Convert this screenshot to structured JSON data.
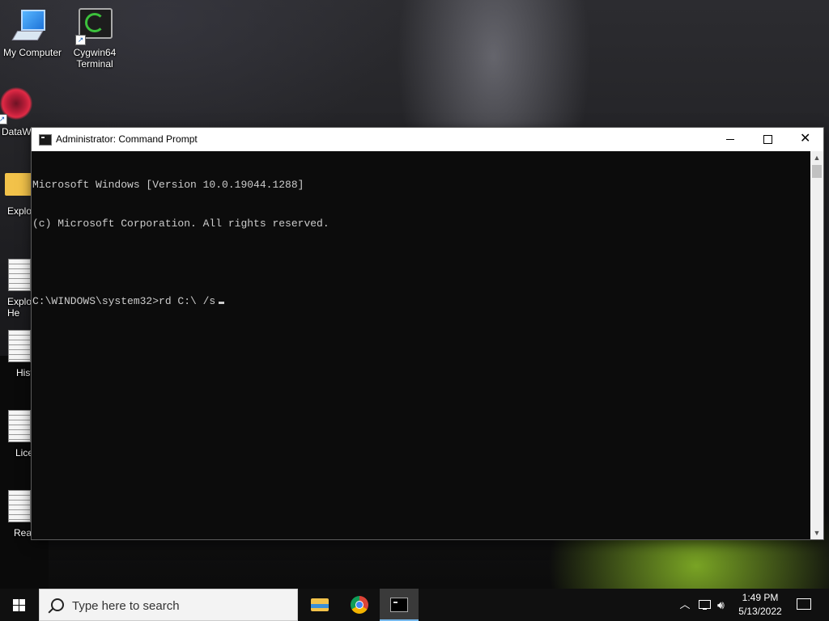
{
  "desktop": {
    "icons": [
      {
        "label": "My Computer"
      },
      {
        "label": "Cygwin64 Terminal"
      },
      {
        "label": "DataW"
      },
      {
        "label": "Explo"
      },
      {
        "label": "Explo He"
      },
      {
        "label": "Hist"
      },
      {
        "label": "Lice"
      },
      {
        "label": "Read"
      }
    ]
  },
  "window": {
    "title": "Administrator: Command Prompt",
    "buttons": {
      "minimize": "minimize-icon",
      "maximize": "maximize-icon",
      "close": "close-icon"
    },
    "console_lines": [
      "Microsoft Windows [Version 10.0.19044.1288]",
      "(c) Microsoft Corporation. All rights reserved.",
      "",
      "C:\\WINDOWS\\system32>rd C:\\ /s"
    ],
    "text_color": "#cccccc",
    "background_color": "#0c0c0c"
  },
  "taskbar": {
    "search_placeholder": "Type here to search",
    "apps": [
      "File Explorer",
      "Google Chrome",
      "Command Prompt"
    ],
    "active_app": "Command Prompt",
    "tray": {
      "time": "1:49 PM",
      "date": "5/13/2022"
    },
    "accent_color": "#76b9ed"
  }
}
